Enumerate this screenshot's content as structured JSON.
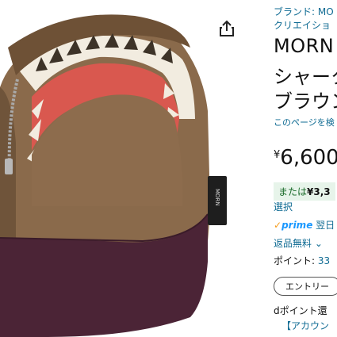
{
  "product": {
    "brand_line": "ブランド: MO",
    "brand_line2": "クリエイショ",
    "title_line1": "MORN",
    "title_line2": "シャーク",
    "title_line3": "ブラウン",
    "page_link": "このページを検",
    "price_currency": "¥",
    "price_amount": "6,600",
    "deal_prefix": "または",
    "deal_amount": "¥3,3",
    "select_label": "選択",
    "prime_label": "prime",
    "prime_delivery": "翌日",
    "returns_label": "返品無料",
    "points_label": "ポイント:",
    "points_value": "33",
    "entry_button": "エントリー",
    "dpoint_label": "dポイント還",
    "account_link": "【アカウン"
  },
  "icons": {
    "share": "share-icon",
    "brand_tag": "morn-logo"
  },
  "colors": {
    "link": "#0f6b93",
    "prime_check": "#f59d1c",
    "prime_word": "#1a98ff",
    "bag_brown": "#8a6a4b",
    "bag_purple": "#4b2436",
    "shark_red": "#d9584f"
  }
}
